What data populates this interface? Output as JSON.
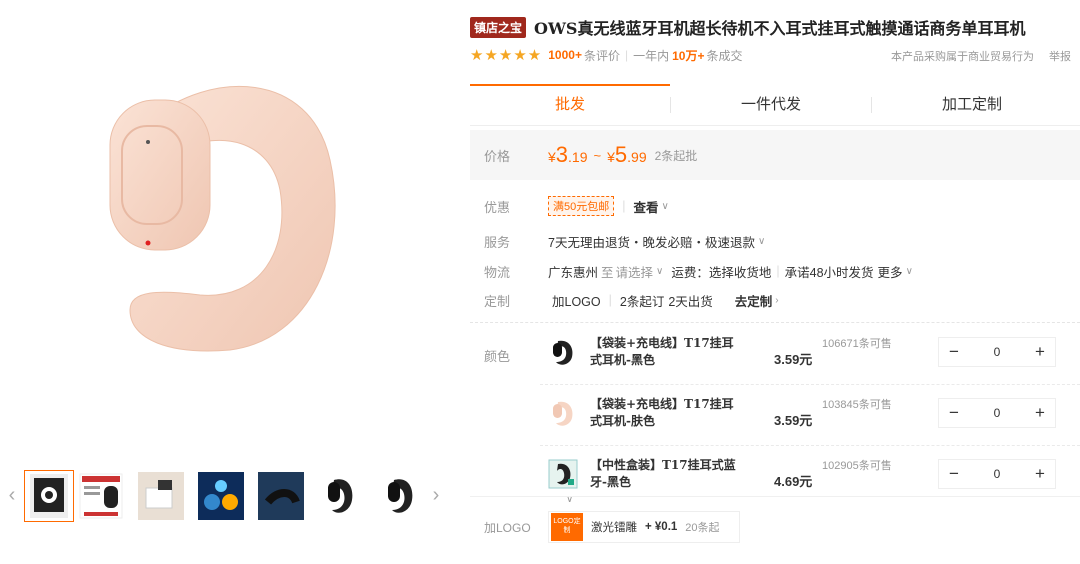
{
  "gallery": {
    "prev_arrow": "‹",
    "next_arrow": "›",
    "thumbs": [
      "thumb-1",
      "thumb-2",
      "thumb-3",
      "thumb-4",
      "thumb-5",
      "thumb-6",
      "thumb-7"
    ]
  },
  "header": {
    "shop_badge": "镇店之宝",
    "title": "OWS真无线蓝牙耳机超长待机不入耳式挂耳式触摸通话商务单耳耳机",
    "stars": "★★★★★",
    "reviews_count": "1000+",
    "reviews_label": "条评价",
    "year_label": "一年内",
    "sold_count": "10万+",
    "sold_label": "条成交",
    "trade_note": "本产品采购属于商业贸易行为",
    "report": "举报"
  },
  "tabs": [
    "批发",
    "一件代发",
    "加工定制"
  ],
  "price": {
    "label": "价格",
    "currency": "¥",
    "low_int": "3",
    "low_dec": ".19",
    "tilde": "~",
    "high_int": "5",
    "high_dec": ".99",
    "min_order": "2条起批"
  },
  "promo": {
    "label": "优惠",
    "coupon": "满50元包邮",
    "view": "查看"
  },
  "service": {
    "label": "服务",
    "text": "7天无理由退货・晚发必赔・极速退款"
  },
  "logistics": {
    "label": "物流",
    "origin": "广东惠州",
    "to": "至",
    "select": "请选择",
    "fee": "运费：选择收货地",
    "promise": "承诺48小时发货",
    "more": "更多"
  },
  "custom": {
    "label": "定制",
    "logo": "加LOGO",
    "min": "2条起订",
    "days": "2天出货",
    "go": "去定制"
  },
  "skus": {
    "label": "颜色",
    "items": [
      {
        "name": "【袋装+充电线】T17挂耳式耳机-黑色",
        "price": "3.59元",
        "stock": "106671条可售",
        "qty": "0"
      },
      {
        "name": "【袋装+充电线】T17挂耳式耳机-肤色",
        "price": "3.59元",
        "stock": "103845条可售",
        "qty": "0"
      },
      {
        "name": "【中性盒装】T17挂耳式蓝牙-黑色",
        "price": "4.69元",
        "stock": "102905条可售",
        "qty": "0"
      }
    ],
    "minus": "−",
    "plus": "+"
  },
  "addon": {
    "label": "加LOGO",
    "thumb_text": "LOGO定制",
    "name": "激光镭雕",
    "price": "+ ¥0.1",
    "min": "20条起"
  },
  "colors": {
    "accent": "#ff6a00",
    "badge": "#a0281c",
    "earbud_skin": "#f6d5c4"
  }
}
